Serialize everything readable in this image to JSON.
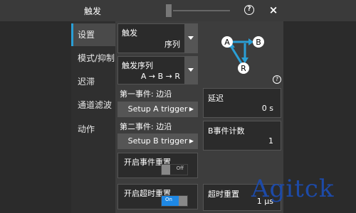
{
  "titlebar": {
    "title": "触发",
    "help_glyph": "?",
    "close_glyph": "×"
  },
  "sidebar": {
    "items": [
      {
        "label": "设置",
        "active": true
      },
      {
        "label": "模式/抑制"
      },
      {
        "label": "迟滞"
      },
      {
        "label": "通道滤波"
      },
      {
        "label": "动作"
      }
    ]
  },
  "trigger": {
    "label": "触发",
    "value": "序列"
  },
  "sequence": {
    "label": "触发序列",
    "value": "A → B → R"
  },
  "diagram": {
    "node_a": "A",
    "node_b": "B",
    "node_r": "R"
  },
  "event1": {
    "label": "第一事件: 边沿",
    "button": "Setup A trigger"
  },
  "event2": {
    "label": "第二事件: 边沿",
    "button": "Setup B trigger"
  },
  "delay": {
    "label": "延迟",
    "value": "0 s"
  },
  "b_count": {
    "label": "B事件计数",
    "value": "1"
  },
  "event_reset": {
    "label": "开启事件重置",
    "state": "Off"
  },
  "timeout_reset_enable": {
    "label": "开启超时重置",
    "state": "On"
  },
  "timeout_reset": {
    "label": "超时重置",
    "value": "1 µs"
  },
  "help_glyph": "?",
  "setup_arrow": "▶",
  "watermark": "Agitck",
  "colors": {
    "accent": "#2a9fd6",
    "toggle_on": "#1e88e5",
    "watermark": "#1d4aa8"
  }
}
